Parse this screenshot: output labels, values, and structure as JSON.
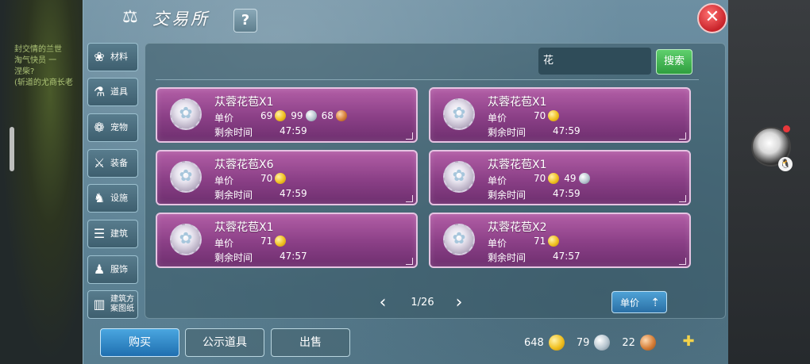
{
  "window": {
    "title": "交易所"
  },
  "background": {
    "chat_lines": [
      "封交情的兰世",
      "淘气快员 一",
      "涅柴?",
      "(斩道的尤商长老"
    ]
  },
  "categories": [
    {
      "label": "材料",
      "icon": "materials-icon"
    },
    {
      "label": "道具",
      "icon": "potion-icon"
    },
    {
      "label": "宠物",
      "icon": "paw-icon"
    },
    {
      "label": "装备",
      "icon": "equipment-icon"
    },
    {
      "label": "设施",
      "icon": "facility-icon"
    },
    {
      "label": "建筑",
      "icon": "building-icon"
    },
    {
      "label": "服饰",
      "icon": "clothing-icon"
    },
    {
      "label": "建筑方案图纸",
      "icon": "blueprint-icon"
    }
  ],
  "search": {
    "value": "花",
    "button_label": "搜索"
  },
  "labels": {
    "unit_price": "单价",
    "remaining_time": "剩余时间"
  },
  "listings": [
    {
      "name": "苁蓉花苞X1",
      "price": [
        {
          "amount": "69",
          "coin": "gold"
        },
        {
          "amount": "99",
          "coin": "silver"
        },
        {
          "amount": "68",
          "coin": "copper"
        }
      ],
      "time": "47:59"
    },
    {
      "name": "苁蓉花苞X1",
      "price": [
        {
          "amount": "70",
          "coin": "gold"
        }
      ],
      "time": "47:59"
    },
    {
      "name": "苁蓉花苞X6",
      "price": [
        {
          "amount": "70",
          "coin": "gold"
        }
      ],
      "time": "47:59"
    },
    {
      "name": "苁蓉花苞X1",
      "price": [
        {
          "amount": "70",
          "coin": "gold"
        },
        {
          "amount": "49",
          "coin": "silver"
        }
      ],
      "time": "47:59"
    },
    {
      "name": "苁蓉花苞X1",
      "price": [
        {
          "amount": "71",
          "coin": "gold"
        }
      ],
      "time": "47:57"
    },
    {
      "name": "苁蓉花苞X2",
      "price": [
        {
          "amount": "71",
          "coin": "gold"
        }
      ],
      "time": "47:57"
    }
  ],
  "pager": {
    "text": "1/26"
  },
  "sort": {
    "label": "单价"
  },
  "actions": {
    "buy": "购买",
    "public": "公示道具",
    "sell": "出售"
  },
  "wallet": {
    "gold": "648",
    "silver": "79",
    "copper": "22"
  },
  "colors": {
    "card_bg": "#8a3f86",
    "buy_button": "#1f6fb0",
    "search_button": "#2f9e3f",
    "close_button": "#c8232a"
  }
}
